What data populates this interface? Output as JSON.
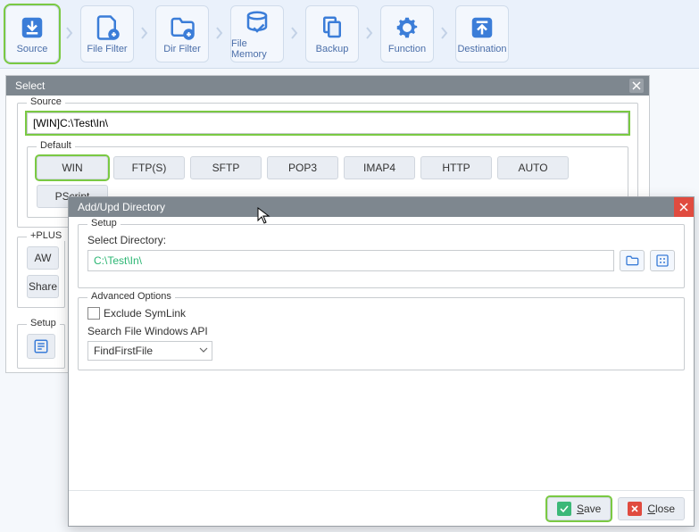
{
  "toolbar": {
    "items": [
      {
        "label": "Source",
        "icon": "download"
      },
      {
        "label": "File Filter",
        "icon": "file-plus"
      },
      {
        "label": "Dir Filter",
        "icon": "folder-plus"
      },
      {
        "label": "File Memory",
        "icon": "db-check"
      },
      {
        "label": "Backup",
        "icon": "copy"
      },
      {
        "label": "Function",
        "icon": "gear"
      },
      {
        "label": "Destination",
        "icon": "upload"
      }
    ]
  },
  "select_window": {
    "title": "Select",
    "source_legend": "Source",
    "source_value": "[WIN]C:\\Test\\In\\",
    "default_legend": "Default",
    "protocols": [
      "WIN",
      "FTP(S)",
      "SFTP",
      "POP3",
      "IMAP4",
      "HTTP",
      "AUTO",
      "PScript"
    ],
    "plus_legend": "+PLUS",
    "plus_left": [
      "AW",
      "Share"
    ],
    "setup_legend": "Setup"
  },
  "dialog": {
    "title": "Add/Upd Directory",
    "setup_legend": "Setup",
    "select_dir_label": "Select Directory:",
    "directory_value": "C:\\Test\\In\\",
    "advanced_legend": "Advanced  Options",
    "exclude_symlink_label": "Exclude SymLink",
    "search_api_label": "Search File Windows API",
    "search_api_value": "FindFirstFile",
    "save_label": "Save",
    "close_label": "Close"
  }
}
